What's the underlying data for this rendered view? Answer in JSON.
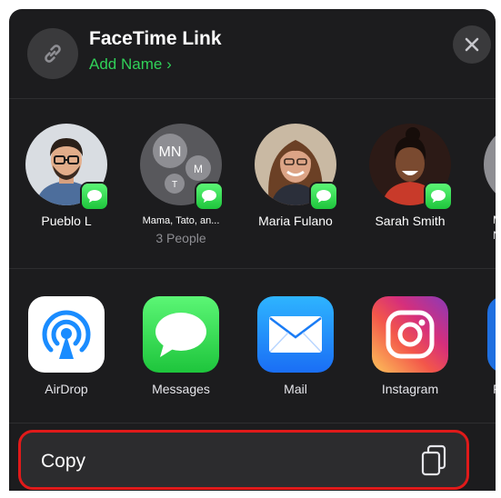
{
  "header": {
    "title": "FaceTime Link",
    "subtitle": "Add Name",
    "subtitle_chevron": "›",
    "link_icon": "link-icon",
    "close_icon": "close-icon"
  },
  "people": [
    {
      "name": "Pueblo L",
      "sub": "",
      "badge": "messages-badge"
    },
    {
      "name": "Mama, Tato, an...",
      "sub": "3 People",
      "initials": [
        "MN",
        "M",
        "T"
      ],
      "badge": "messages-badge"
    },
    {
      "name": "Maria Fulano",
      "sub": "",
      "badge": "messages-badge"
    },
    {
      "name": "Sarah Smith",
      "sub": "",
      "badge": "messages-badge"
    },
    {
      "name": "M",
      "sub": "N",
      "badge": ""
    }
  ],
  "apps": [
    {
      "label": "AirDrop",
      "icon": "airdrop-icon"
    },
    {
      "label": "Messages",
      "icon": "messages-icon"
    },
    {
      "label": "Mail",
      "icon": "mail-icon"
    },
    {
      "label": "Instagram",
      "icon": "instagram-icon"
    },
    {
      "label": "F",
      "icon": "app-icon-partial"
    }
  ],
  "copy_action": {
    "label": "Copy",
    "icon": "copy-icon"
  },
  "colors": {
    "sheet": "#1c1c1e",
    "accent_green": "#30d158",
    "highlight": "#e01a1a"
  }
}
